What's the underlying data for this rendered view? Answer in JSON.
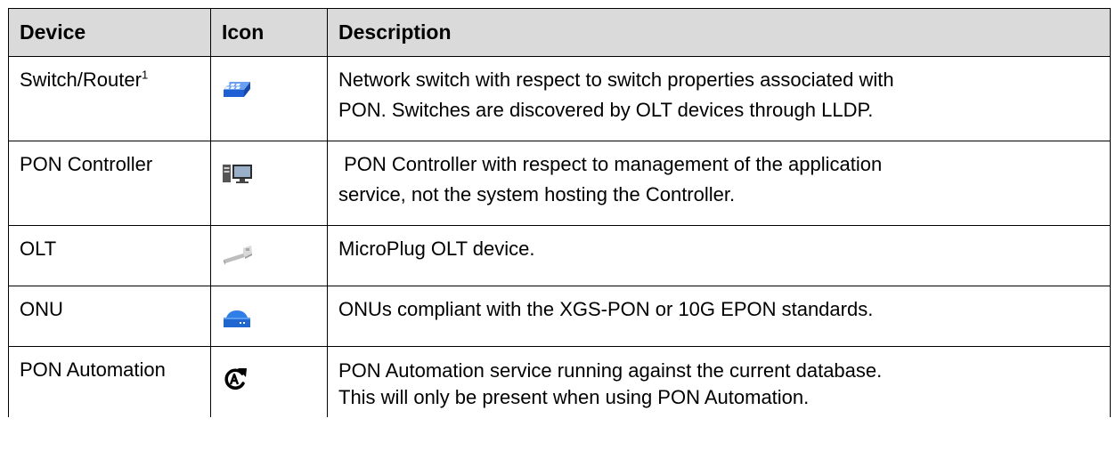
{
  "table": {
    "headers": {
      "device": "Device",
      "icon": "Icon",
      "description": "Description"
    },
    "rows": [
      {
        "device": "Switch/Router",
        "device_sup": "1",
        "icon": "switch-icon",
        "description_line1": "Network switch with respect to switch properties associated with",
        "description_line2": "PON. Switches are discovered by OLT devices through LLDP.",
        "icon_color": "#2f6fe0"
      },
      {
        "device": "PON Controller",
        "icon": "pc-icon",
        "description_line1": " PON Controller with respect to management of the application",
        "description_line2": "service, not the system hosting the Controller.",
        "icon_color": "#3a3a3a"
      },
      {
        "device": "OLT",
        "icon": "olt-plug-icon",
        "description_line1": "MicroPlug OLT device.",
        "icon_color": "#9a9a9a"
      },
      {
        "device": "ONU",
        "icon": "onu-icon",
        "description_line1": "ONUs compliant with the XGS-PON or 10G EPON standards.",
        "icon_color": "#1f6fd6"
      },
      {
        "device": "PON Automation",
        "icon": "automation-icon",
        "description_line1": "PON Automation service running against the current database.",
        "description_line2": "This will only be present when using PON Automation.",
        "icon_color": "#000000"
      }
    ]
  }
}
